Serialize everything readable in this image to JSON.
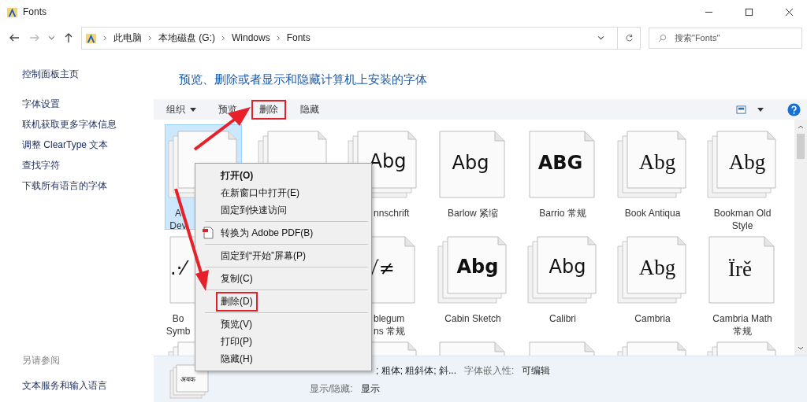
{
  "window": {
    "title": "Fonts"
  },
  "address": {
    "crumbs": [
      "此电脑",
      "本地磁盘 (G:)",
      "Windows",
      "Fonts"
    ],
    "search_placeholder": "搜索\"Fonts\""
  },
  "sidebar": {
    "home": "控制面板主页",
    "links": [
      "字体设置",
      "联机获取更多字体信息",
      "调整 ClearType 文本",
      "查找字符",
      "下载所有语言的字体"
    ],
    "see_also_title": "另请参阅",
    "see_also": [
      "文本服务和输入语言"
    ]
  },
  "heading": "预览、删除或者显示和隐藏计算机上安装的字体",
  "toolbar": {
    "items": [
      {
        "label": "组织",
        "dropdown": true,
        "highlighted": false
      },
      {
        "label": "预览",
        "dropdown": false,
        "highlighted": false
      },
      {
        "label": "删除",
        "dropdown": false,
        "highlighted": true
      },
      {
        "label": "隐藏",
        "dropdown": false,
        "highlighted": false
      }
    ]
  },
  "fonts": [
    {
      "kind": "family",
      "selected": true,
      "lines": [
        "A",
        "Dev"
      ]
    },
    {
      "kind": "family"
    },
    {
      "kind": "family",
      "selected": false,
      "sample": "Abg",
      "serif": false,
      "bold": false,
      "lines": [
        "nnschrift"
      ]
    },
    {
      "kind": "single",
      "selected": false,
      "sample": "Abg",
      "serif": false,
      "bold": false,
      "lines": [
        "Barlow 紧缩"
      ]
    },
    {
      "kind": "single",
      "selected": false,
      "sample": "ABG",
      "serif": false,
      "bold": true,
      "lines": [
        "Barrio 常规"
      ]
    },
    {
      "kind": "family",
      "selected": false,
      "sample": "Abg",
      "serif": true,
      "bold": false,
      "lines": [
        "Book Antiqua"
      ]
    },
    {
      "kind": "family",
      "selected": false,
      "sample": "Abg",
      "serif": true,
      "bold": false,
      "lines": [
        "Bookman Old",
        "Style"
      ]
    },
    {
      "kind": "single",
      "selected": false,
      "sample": ".·⁄",
      "serif": false,
      "bold": false,
      "lines": [
        "Bo",
        "Symb"
      ]
    },
    {
      "kind": "covered"
    },
    {
      "kind": "single",
      "selected": false,
      "sample": "√≠",
      "serif": false,
      "bold": false,
      "lines": [
        "blegum",
        "ns 常规"
      ]
    },
    {
      "kind": "family",
      "selected": false,
      "sample": "Abg",
      "serif": false,
      "bold": true,
      "lines": [
        "Cabin Sketch"
      ]
    },
    {
      "kind": "family",
      "selected": false,
      "sample": "Abg",
      "serif": false,
      "bold": false,
      "lines": [
        "Calibri"
      ]
    },
    {
      "kind": "family",
      "selected": false,
      "sample": "Abg",
      "serif": true,
      "bold": false,
      "lines": [
        "Cambria"
      ]
    },
    {
      "kind": "single",
      "selected": false,
      "sample": "Ïrě",
      "serif": true,
      "bold": false,
      "lines": [
        "Cambria Math",
        "常规"
      ]
    },
    {
      "kind": "family",
      "selected": false
    },
    {
      "kind": "covered"
    },
    {
      "kind": "family",
      "selected": false
    },
    {
      "kind": "single",
      "selected": false
    },
    {
      "kind": "single",
      "selected": false
    },
    {
      "kind": "family",
      "selected": false
    },
    {
      "kind": "family",
      "selected": false
    }
  ],
  "context_menu": [
    {
      "kind": "item",
      "label": "打开(O)",
      "bold": true,
      "highlighted": false
    },
    {
      "kind": "item",
      "label": "在新窗口中打开(E)",
      "bold": false,
      "highlighted": false
    },
    {
      "kind": "item",
      "label": "固定到快速访问",
      "bold": false,
      "highlighted": false
    },
    {
      "kind": "separator"
    },
    {
      "kind": "item",
      "label": "转换为 Adobe PDF(B)",
      "bold": false,
      "icon": true,
      "highlighted": false
    },
    {
      "kind": "separator"
    },
    {
      "kind": "item",
      "label": "固定到“开始”屏幕(P)",
      "bold": false,
      "highlighted": false
    },
    {
      "kind": "separator"
    },
    {
      "kind": "item",
      "label": "复制(C)",
      "bold": false,
      "highlighted": false
    },
    {
      "kind": "separator"
    },
    {
      "kind": "item",
      "label": "删除(D)",
      "bold": false,
      "highlighted": true
    },
    {
      "kind": "separator"
    },
    {
      "kind": "item",
      "label": "预览(V)",
      "bold": false,
      "highlighted": false
    },
    {
      "kind": "item",
      "label": "打印(P)",
      "bold": false,
      "highlighted": false
    },
    {
      "kind": "item",
      "label": "隐藏(H)",
      "bold": false,
      "highlighted": false
    }
  ],
  "details": {
    "thumbnail_sample": "अबक",
    "styles": "; 粗体; 粗斜体; 斜...",
    "fields": [
      {
        "label": "字体嵌入性:",
        "value": "可编辑"
      },
      {
        "label": "显示/隐藏:",
        "value": "显示"
      }
    ]
  }
}
